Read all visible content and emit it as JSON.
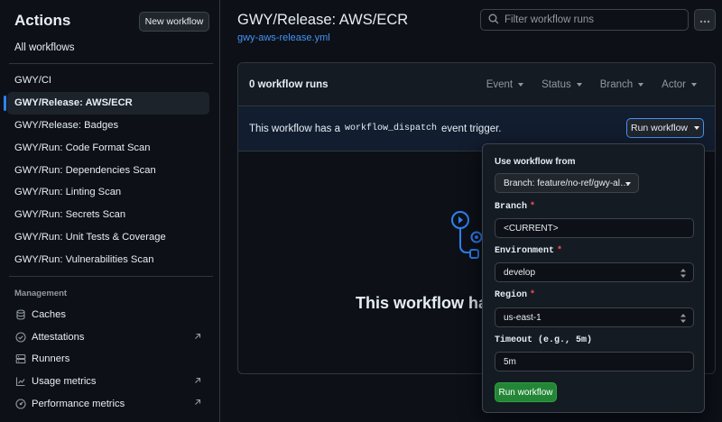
{
  "sidebar": {
    "title": "Actions",
    "new_workflow_label": "New workflow",
    "all_workflows_label": "All workflows",
    "workflows": [
      {
        "label": "GWY/CI",
        "active": false
      },
      {
        "label": "GWY/Release: AWS/ECR",
        "active": true
      },
      {
        "label": "GWY/Release: Badges",
        "active": false
      },
      {
        "label": "GWY/Run: Code Format Scan",
        "active": false
      },
      {
        "label": "GWY/Run: Dependencies Scan",
        "active": false
      },
      {
        "label": "GWY/Run: Linting Scan",
        "active": false
      },
      {
        "label": "GWY/Run: Secrets Scan",
        "active": false
      },
      {
        "label": "GWY/Run: Unit Tests & Coverage",
        "active": false
      },
      {
        "label": "GWY/Run: Vulnerabilities Scan",
        "active": false
      }
    ],
    "management_heading": "Management",
    "management": [
      {
        "label": "Caches",
        "icon": "database-icon",
        "external": false
      },
      {
        "label": "Attestations",
        "icon": "check-circle-icon",
        "external": true
      },
      {
        "label": "Runners",
        "icon": "server-icon",
        "external": false
      },
      {
        "label": "Usage metrics",
        "icon": "graph-icon",
        "external": true
      },
      {
        "label": "Performance metrics",
        "icon": "meter-icon",
        "external": true
      }
    ]
  },
  "header": {
    "title": "GWY/Release: AWS/ECR",
    "workflow_file": "gwy-aws-release.yml",
    "search_placeholder": "Filter workflow runs",
    "more_icon": "kebab-horizontal-icon"
  },
  "runs": {
    "count_label": "0 workflow runs",
    "filters": [
      "Event",
      "Status",
      "Branch",
      "Actor"
    ],
    "dispatch_prefix": "This workflow has a",
    "dispatch_code": "workflow_dispatch",
    "dispatch_suffix": "event trigger.",
    "run_workflow_label": "Run workflow",
    "empty_title": "This workflow has no runs yet."
  },
  "run_panel": {
    "use_from_label": "Use workflow from",
    "branch_selector": "Branch: feature/no-ref/gwy-al…",
    "fields": {
      "branch_label": "Branch",
      "branch_value": "<CURRENT>",
      "environment_label": "Environment",
      "environment_value": "develop",
      "region_label": "Region",
      "region_value": "us-east-1",
      "timeout_label": "Timeout (e.g., 5m)",
      "timeout_value": "5m"
    },
    "required_marker": "*",
    "submit_label": "Run workflow"
  },
  "colors": {
    "background": "#0d1117",
    "accent": "#2f81f7",
    "link": "#4493f8",
    "success": "#238636",
    "danger": "#f85149"
  }
}
